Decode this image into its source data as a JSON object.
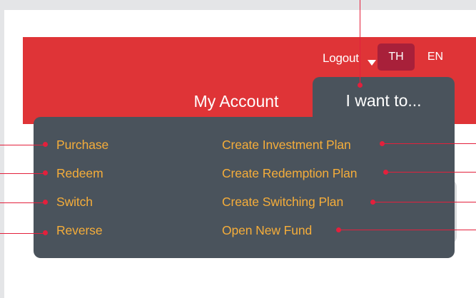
{
  "header": {
    "logout_label": "Logout",
    "languages": [
      {
        "label": "TH",
        "active": true
      },
      {
        "label": "EN",
        "active": false
      }
    ]
  },
  "nav": {
    "tabs": [
      {
        "label": "My Account",
        "active": false
      },
      {
        "label": "I want to...",
        "active": true
      }
    ]
  },
  "menu": {
    "left": [
      {
        "label": "Purchase"
      },
      {
        "label": "Redeem"
      },
      {
        "label": "Switch"
      },
      {
        "label": "Reverse"
      }
    ],
    "right": [
      {
        "label": "Create Investment Plan"
      },
      {
        "label": "Create Redemption Plan"
      },
      {
        "label": "Create Switching Plan"
      },
      {
        "label": "Open New Fund"
      }
    ]
  },
  "colors": {
    "header_red": "#df3437",
    "active_lang": "#a8203a",
    "panel": "#4a535c",
    "menu_text": "#f5ad3a",
    "annotation": "#e3203c"
  }
}
